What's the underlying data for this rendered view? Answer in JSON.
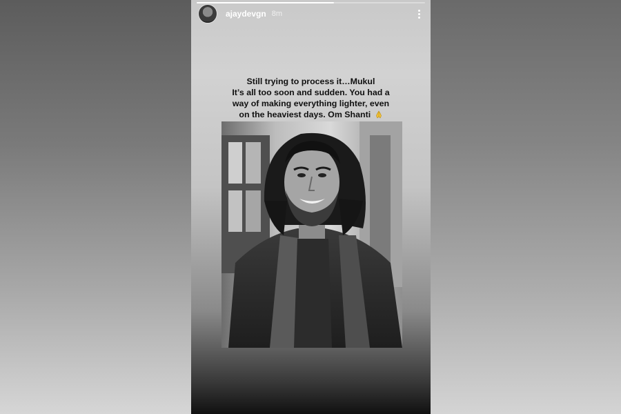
{
  "story": {
    "username": "ajaydevgn",
    "time": "8m",
    "progress": 0.6,
    "caption_lines": [
      "Still trying to process it…Mukul",
      "It’s all too soon and sudden. You had a",
      "way of making everything lighter, even",
      "on the heaviest days. Om Shanti"
    ],
    "emoji": "🙏"
  },
  "icons": {
    "menu": "more-vertical-icon",
    "avatar": "profile-avatar",
    "emoji": "folded-hands-icon"
  }
}
